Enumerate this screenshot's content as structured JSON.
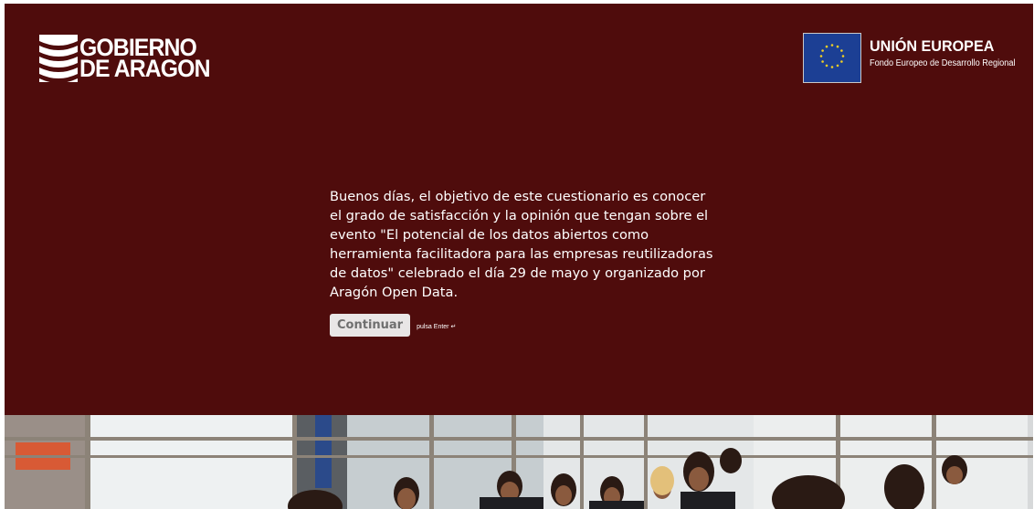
{
  "branding": {
    "gobierno_line1": "GOBIERNO",
    "gobierno_line2": "DE ARAGON",
    "eu_title": "UNIÓN EUROPEA",
    "eu_subtitle": "Fondo Europeo de Desarrollo Regional"
  },
  "intro": {
    "text": "Buenos días, el objetivo de este cuestionario es conocer el grado de satisfacción y la opinión que tengan sobre el evento \"El potencial de los datos abiertos como herramienta facilitadora para las empresas reutilizadoras de datos\" celebrado el día 29 de mayo y organizado por Aragón Open Data."
  },
  "actions": {
    "continue_label": "Continuar",
    "hint": "pulsa Enter ↵"
  },
  "colors": {
    "background": "#4f0c0c",
    "eu_blue": "#1c3f94",
    "eu_star": "#f2d024",
    "button_bg": "#e9e6e6"
  },
  "icons": {
    "gobierno_logo": "aragon-stripes-logo",
    "eu_flag": "eu-flag-icon"
  }
}
